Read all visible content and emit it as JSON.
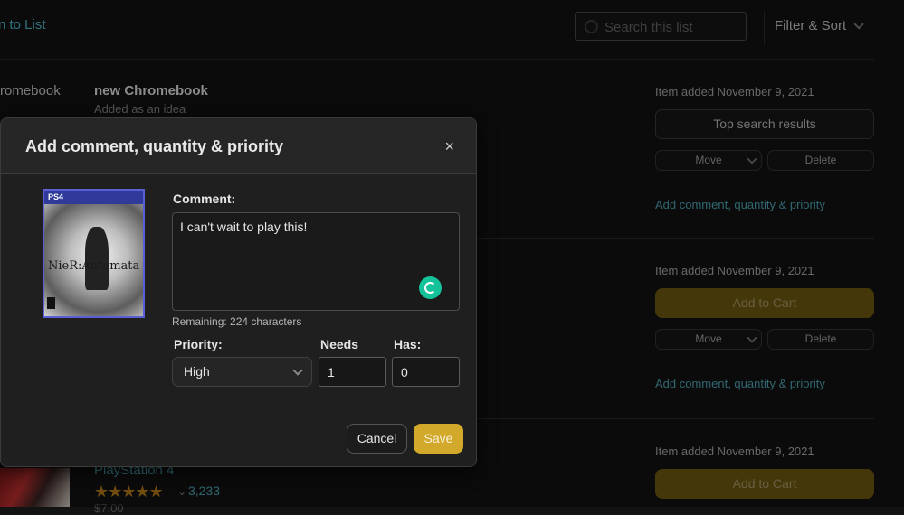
{
  "header": {
    "back_link": "n to List",
    "search_placeholder": "Search this list",
    "filter_label": "Filter & Sort"
  },
  "items": [
    {
      "crumb": "romebook",
      "title": "new Chromebook",
      "subtitle": "Added as an idea",
      "added": "Item added November 9, 2021",
      "primary_button": "Top search results",
      "move": "Move",
      "delete": "Delete",
      "link": "Add comment, quantity & priority"
    },
    {
      "added": "Item added November 9, 2021",
      "primary_button": "Add to Cart",
      "move": "Move",
      "delete": "Delete",
      "link": "Add comment, quantity & priority"
    },
    {
      "title": "PlayStation 4",
      "stars": "★★★★★",
      "review_count": "3,233",
      "price": "$7.00",
      "added": "Item added November 9, 2021",
      "primary_button": "Add to Cart"
    }
  ],
  "modal": {
    "title": "Add comment, quantity & priority",
    "close": "×",
    "cover": {
      "platform": "PS4",
      "logo": "NieR:Automata"
    },
    "comment_label": "Comment:",
    "comment_value": "I can't wait to play this!",
    "remaining": "Remaining: 224 characters",
    "priority_label": "Priority:",
    "priority_value": "High",
    "needs_label": "Needs",
    "needs_value": "1",
    "has_label": "Has:",
    "has_value": "0",
    "cancel": "Cancel",
    "save": "Save"
  },
  "colors": {
    "accent_link": "#4fa7b7",
    "save": "#d2a92a",
    "cart_dimmed": "#6f5b13"
  }
}
